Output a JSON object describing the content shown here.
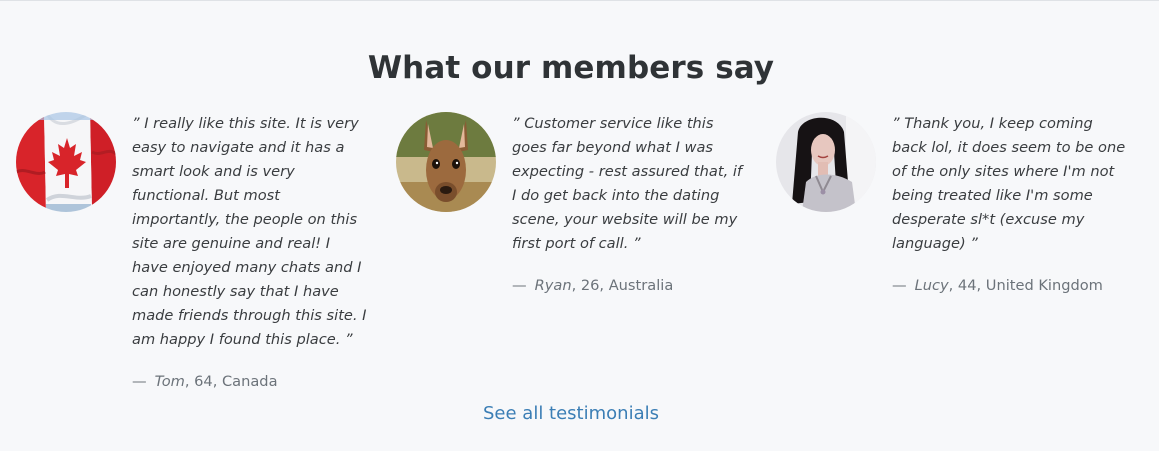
{
  "section": {
    "title": "What our members say",
    "see_all_label": "See all testimonials"
  },
  "testimonials": [
    {
      "quote": "” I really like this site. It is very easy to navigate and it has a smart look and is very functional. But most importantly, the people on this site are genuine and real! I have enjoyed many chats and I can honestly say that I have made friends through this site. I am happy I found this place. ”",
      "dash": "—",
      "name": "Tom",
      "details": ", 64, Canada",
      "avatar_icon": "canada-flag-avatar"
    },
    {
      "quote": "” Customer service like this goes far beyond what I was expecting - rest assured that, if I do get back into the dating scene, your website will be my first port of call. ”",
      "dash": "—",
      "name": "Ryan",
      "details": ", 26, Australia",
      "avatar_icon": "kangaroo-avatar"
    },
    {
      "quote": "” Thank you, I keep coming back lol, it does seem to be one of the only sites where I'm not being treated like I'm some desperate sl*t (excuse my language) ”",
      "dash": "—",
      "name": "Lucy",
      "details": ", 44, United Kingdom",
      "avatar_icon": "woman-portrait-avatar"
    }
  ],
  "colors": {
    "background": "#f7f8fa",
    "heading": "#2f3336",
    "quote_text": "#3a3d40",
    "attribution_text": "#6c737a",
    "link": "#3b7eb5"
  }
}
